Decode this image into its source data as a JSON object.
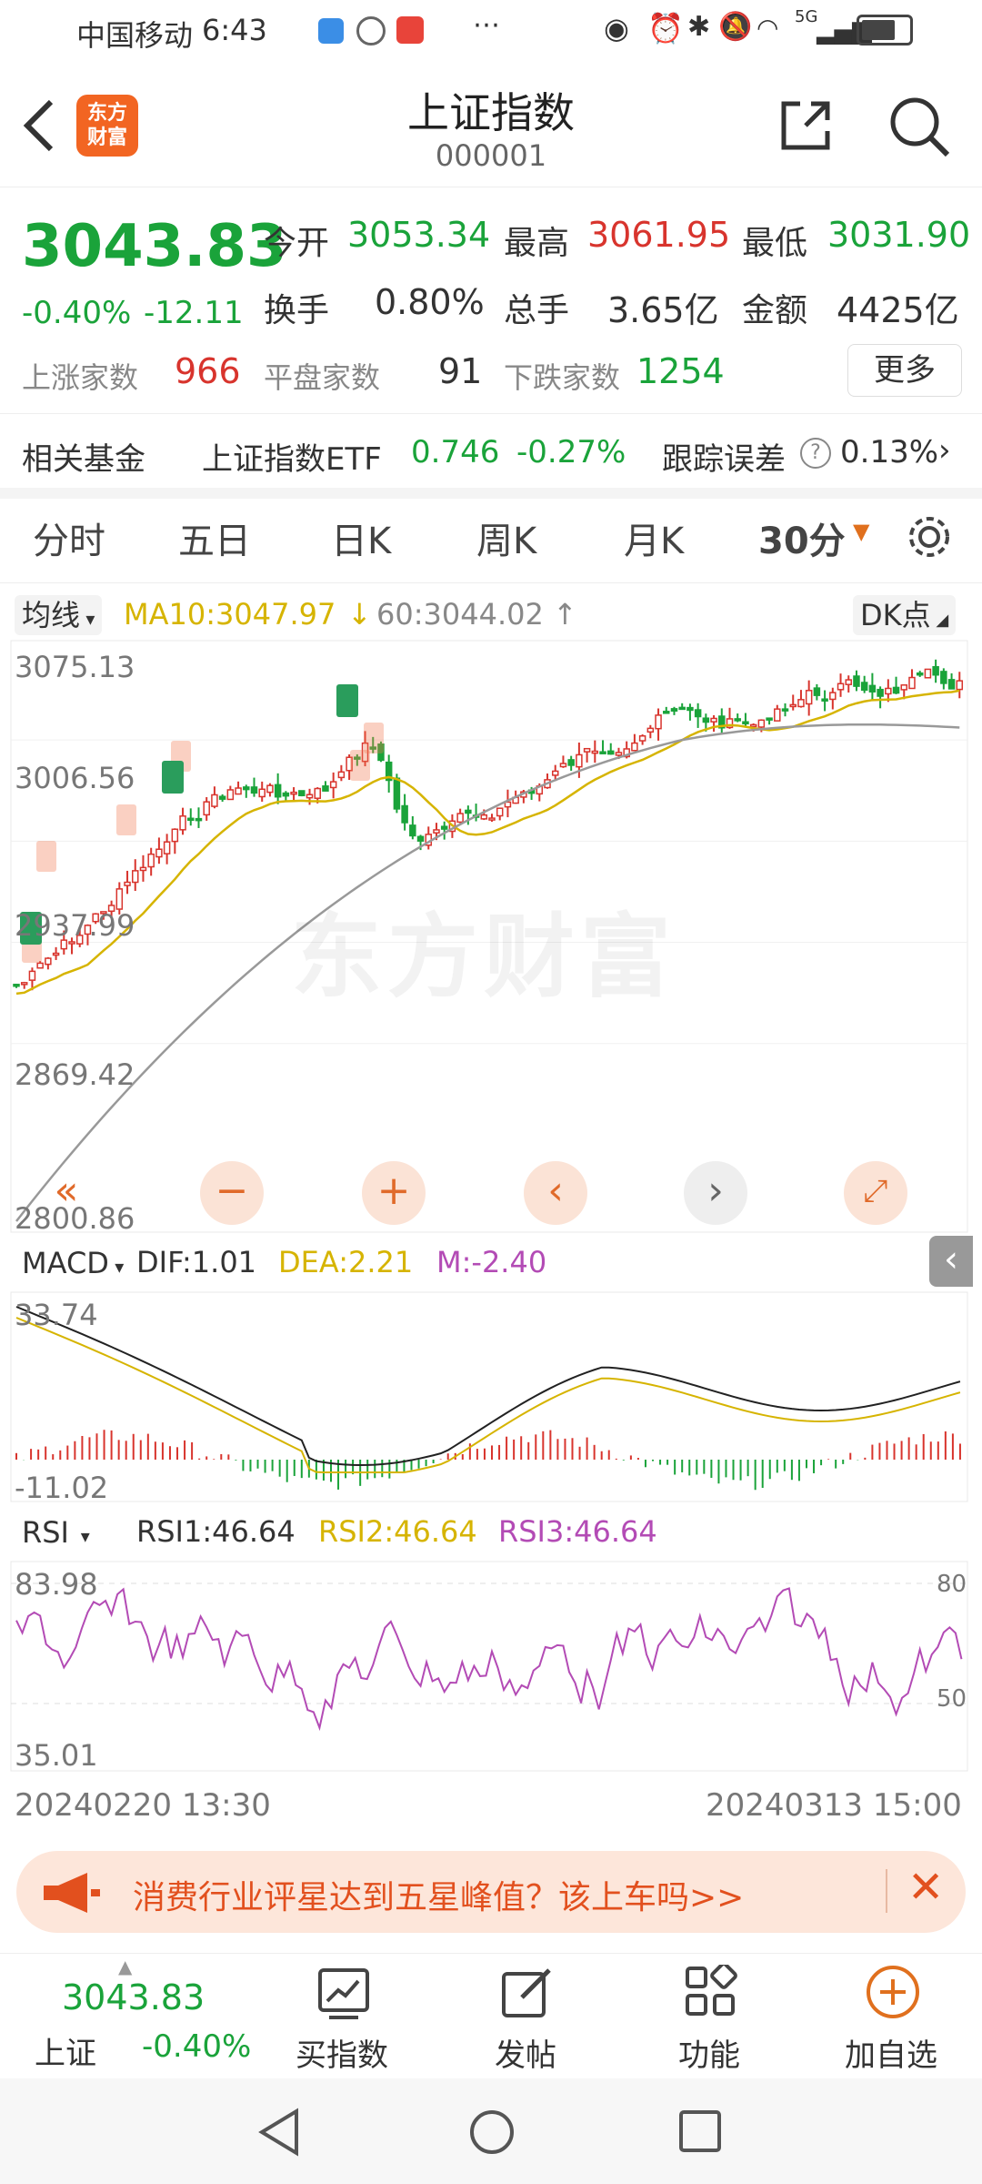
{
  "status_bar": {
    "carrier": "中国移动",
    "time": "6:43",
    "network": "5G"
  },
  "header": {
    "title": "上证指数",
    "code": "000001",
    "logo_text_1": "东方",
    "logo_text_2": "财富"
  },
  "quote": {
    "price": "3043.83",
    "change_pct": "-0.40%",
    "change": "-12.11",
    "open_label": "今开",
    "open": "3053.34",
    "high_label": "最高",
    "high": "3061.95",
    "low_label": "最低",
    "low": "3031.90",
    "turnover_label": "换手",
    "turnover": "0.80%",
    "volume_label": "总手",
    "volume": "3.65亿",
    "amount_label": "金额",
    "amount": "4425亿",
    "up_label": "上涨家数",
    "up": "966",
    "flat_label": "平盘家数",
    "flat": "91",
    "down_label": "下跌家数",
    "down": "1254",
    "more_label": "更多"
  },
  "fund": {
    "label": "相关基金",
    "name": "上证指数ETF",
    "price": "0.746",
    "pct": "-0.27%",
    "err_label": "跟踪误差",
    "err": "0.13%"
  },
  "tabs": [
    {
      "label": "分时"
    },
    {
      "label": "五日"
    },
    {
      "label": "日K"
    },
    {
      "label": "周K"
    },
    {
      "label": "月K"
    },
    {
      "label": "30分"
    }
  ],
  "main_chart": {
    "indicator_select": "均线",
    "ma10": "MA10:3047.97",
    "ma60": "60:3044.02",
    "dk_label": "DK点",
    "y_labels": [
      "3075.13",
      "3006.56",
      "2937.99",
      "2869.42",
      "2800.86"
    ],
    "watermark": "东方财富"
  },
  "macd": {
    "select": "MACD",
    "dif": "DIF:1.01",
    "dea": "DEA:2.21",
    "m": "M:-2.40",
    "y_top": "33.74",
    "y_bottom": "-11.02"
  },
  "rsi": {
    "select": "RSI",
    "rsi1": "RSI1:46.64",
    "rsi2": "RSI2:46.64",
    "rsi3": "RSI3:46.64",
    "y_top": "83.98",
    "y_bottom": "35.01",
    "ref_80": "80",
    "ref_50": "50"
  },
  "x_axis": {
    "start": "20240220 13:30",
    "end": "20240313 15:00"
  },
  "banner": {
    "text": "消费行业评星达到五星峰值？该上车吗>>"
  },
  "bottom_bar": {
    "index_price": "3043.83",
    "index_name": "上证",
    "index_pct": "-0.40%",
    "items": [
      {
        "label": "买指数"
      },
      {
        "label": "发帖"
      },
      {
        "label": "功能"
      },
      {
        "label": "加自选"
      }
    ]
  },
  "colors": {
    "up": "#d8342d",
    "down": "#1aa33a",
    "accent": "#e0701e",
    "ma10": "#d6b400",
    "ma60": "#999999",
    "rsi": "#b34bb5"
  }
}
